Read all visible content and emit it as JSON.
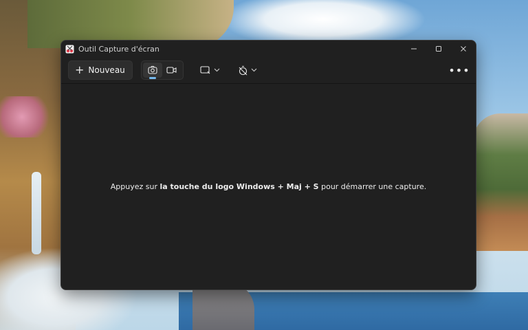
{
  "window": {
    "title": "Outil Capture d'écran",
    "controls": {
      "minimize": "—",
      "maximize": "☐",
      "close": "✕"
    }
  },
  "toolbar": {
    "new_label": "Nouveau",
    "new_icon": "plus-icon",
    "modes": [
      {
        "icon": "camera-icon",
        "active": true
      },
      {
        "icon": "video-icon",
        "active": false
      }
    ],
    "shape_icon": "rectangle-mode-icon",
    "delay_icon": "timer-off-icon",
    "more_label": "•••"
  },
  "content": {
    "prefix": "Appuyez sur ",
    "bold": "la touche du logo Windows + Maj + S",
    "suffix": " pour démarrer une capture."
  },
  "colors": {
    "window_bg": "#202020",
    "accent": "#76b9ed"
  }
}
